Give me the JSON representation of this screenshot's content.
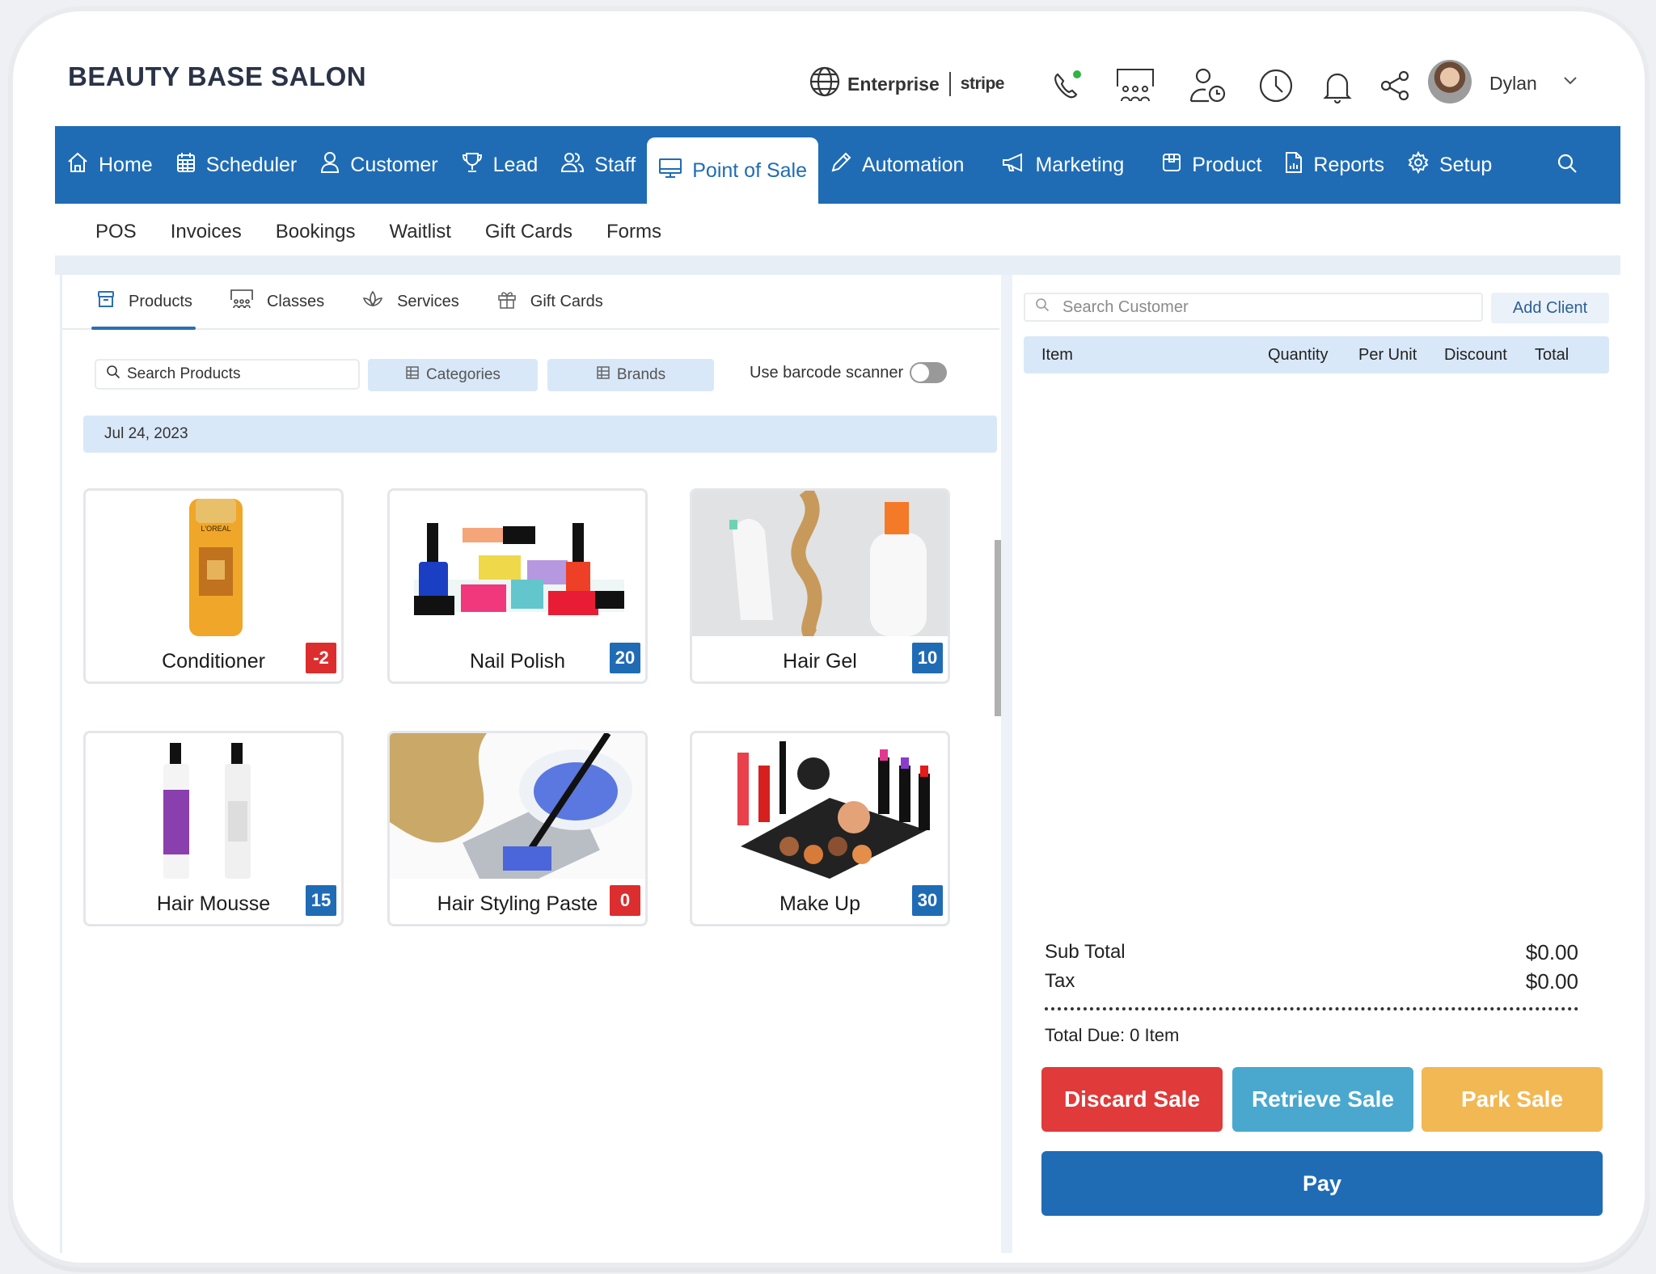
{
  "app": {
    "brand": "BEAUTY BASE SALON"
  },
  "topbar": {
    "plan_label": "Enterprise",
    "payment_provider": "stripe",
    "icons": [
      "globe-icon",
      "phone-icon",
      "classroom-icon",
      "user-clock-icon",
      "clock-icon",
      "bell-icon",
      "share-icon"
    ],
    "phone_status_color": "#2fb344",
    "user_name": "Dylan"
  },
  "nav": {
    "items": [
      {
        "label": "Home",
        "icon": "home-icon"
      },
      {
        "label": "Scheduler",
        "icon": "calendar-icon"
      },
      {
        "label": "Customer",
        "icon": "user-icon"
      },
      {
        "label": "Lead",
        "icon": "trophy-icon"
      },
      {
        "label": "Staff",
        "icon": "users-icon"
      },
      {
        "label": "Point of Sale",
        "icon": "monitor-icon",
        "active": true
      },
      {
        "label": "Automation",
        "icon": "pencil-icon"
      },
      {
        "label": "Marketing",
        "icon": "megaphone-icon"
      },
      {
        "label": "Product",
        "icon": "box-icon"
      },
      {
        "label": "Reports",
        "icon": "report-icon"
      },
      {
        "label": "Setup",
        "icon": "gear-icon"
      }
    ],
    "accent_color": "#1f6cb5"
  },
  "subnav": {
    "items": [
      "POS",
      "Invoices",
      "Bookings",
      "Waitlist",
      "Gift Cards",
      "Forms"
    ]
  },
  "pos": {
    "tabs": [
      {
        "label": "Products",
        "icon": "archive-icon",
        "active": true
      },
      {
        "label": "Classes",
        "icon": "classroom-icon"
      },
      {
        "label": "Services",
        "icon": "lotus-icon"
      },
      {
        "label": "Gift Cards",
        "icon": "gift-icon"
      }
    ],
    "search_placeholder": "Search Products",
    "categories_label": "Categories",
    "brands_label": "Brands",
    "barcode_label": "Use barcode scanner",
    "barcode_enabled": false,
    "date": "Jul 24, 2023",
    "products": [
      {
        "name": "Conditioner",
        "stock": "-2",
        "status": "negative"
      },
      {
        "name": "Nail Polish",
        "stock": "20",
        "status": "positive"
      },
      {
        "name": "Hair Gel",
        "stock": "10",
        "status": "positive"
      },
      {
        "name": "Hair Mousse",
        "stock": "15",
        "status": "positive"
      },
      {
        "name": "Hair Styling Paste",
        "stock": "0",
        "status": "negative"
      },
      {
        "name": "Make Up",
        "stock": "30",
        "status": "positive"
      }
    ]
  },
  "cart": {
    "search_placeholder": "Search Customer",
    "add_client_label": "Add Client",
    "columns": [
      "Item",
      "Quantity",
      "Per Unit",
      "Discount",
      "Total"
    ],
    "subtotal_label": "Sub Total",
    "subtotal_value": "$0.00",
    "tax_label": "Tax",
    "tax_value": "$0.00",
    "total_due_label": "Total Due: 0 Item",
    "buttons": {
      "discard": "Discard Sale",
      "retrieve": "Retrieve Sale",
      "park": "Park Sale",
      "pay": "Pay"
    },
    "colors": {
      "discard": "#e03a3a",
      "retrieve": "#4aa8cf",
      "park": "#f2b854",
      "pay": "#1f6cb5"
    }
  }
}
